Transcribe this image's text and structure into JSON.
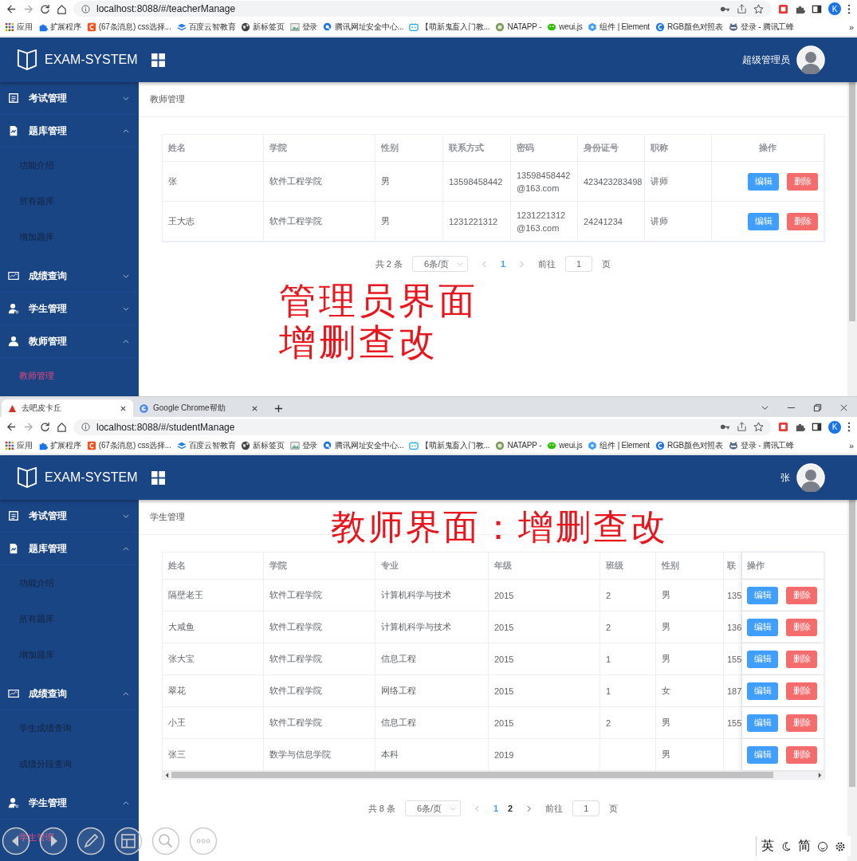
{
  "windows": [
    {
      "address": "localhost:8088/#/teacherManage",
      "profile": "K",
      "bookmarks": [
        "应用",
        "扩展程序",
        "(67条消息) css选择...",
        "百度云智教育",
        "新标签页",
        "登录",
        "腾讯网址安全中心...",
        "【萌新鬼畜入门教...",
        "NATAPP -",
        "weui.js",
        "组件 | Element",
        "RGB颜色对照表",
        "登录 - 腾讯工蜂"
      ],
      "bookmarks_more": "»",
      "app": {
        "logo": "EXAM-SYSTEM",
        "user": "超级管理员",
        "sidebar": [
          {
            "label": "考试管理",
            "expanded": false
          },
          {
            "label": "题库管理",
            "expanded": true,
            "children": [
              {
                "label": "功能介绍",
                "selected": false
              },
              {
                "label": "所有题库",
                "selected": false
              },
              {
                "label": "增加题库",
                "selected": false
              }
            ]
          },
          {
            "label": "成绩查询",
            "expanded": false
          },
          {
            "label": "学生管理",
            "expanded": false
          },
          {
            "label": "教师管理",
            "expanded": true,
            "children": [
              {
                "label": "教师管理",
                "selected": true
              }
            ]
          }
        ],
        "breadcrumb": "教师管理",
        "table": {
          "columns": [
            "姓名",
            "学院",
            "性别",
            "联系方式",
            "密码",
            "身份证号",
            "职称",
            "操作"
          ],
          "rows": [
            {
              "cells": [
                "张",
                "软件工程学院",
                "男",
                "13598458442",
                "13598458442@163.com",
                "423423283498",
                "讲师"
              ],
              "actions": [
                {
                  "kind": "edit",
                  "label": "编辑"
                },
                {
                  "kind": "delete",
                  "label": "删除"
                }
              ]
            },
            {
              "cells": [
                "王大志",
                "软件工程学院",
                "男",
                "1231221312",
                "1231221312@163.com",
                "24241234",
                "讲师"
              ],
              "actions": [
                {
                  "kind": "edit",
                  "label": "编辑"
                },
                {
                  "kind": "delete",
                  "label": "删除"
                }
              ]
            }
          ]
        },
        "pagination": {
          "total": "共 2 条",
          "page_size": "6条/页",
          "pages": [
            {
              "label": "1",
              "selected": true
            }
          ],
          "goto": "前往",
          "goto_value": "1",
          "unit": "页"
        },
        "annotation": [
          "管理员界面",
          "增删查改"
        ]
      }
    },
    {
      "tabs": [
        {
          "title": "去吧皮卡丘",
          "selected": true
        },
        {
          "title": "Google Chrome帮助",
          "selected": false
        }
      ],
      "address": "localhost:8088/#/studentManage",
      "profile": "K",
      "bookmarks": [
        "应用",
        "扩展程序",
        "(67条消息) css选择...",
        "百度云智教育",
        "新标签页",
        "登录",
        "腾讯网址安全中心...",
        "【萌新鬼畜入门教...",
        "NATAPP -",
        "weui.js",
        "组件 | Element",
        "RGB颜色对照表",
        "登录 - 腾讯工蜂"
      ],
      "bookmarks_more": "»",
      "app": {
        "logo": "EXAM-SYSTEM",
        "user": "张",
        "sidebar": [
          {
            "label": "考试管理",
            "expanded": false
          },
          {
            "label": "题库管理",
            "expanded": true,
            "children": [
              {
                "label": "功能介绍",
                "selected": false
              },
              {
                "label": "所有题库",
                "selected": false
              },
              {
                "label": "增加题库",
                "selected": false
              }
            ]
          },
          {
            "label": "成绩查询",
            "expanded": true,
            "children": [
              {
                "label": "学生成绩查询",
                "selected": false
              },
              {
                "label": "成绩分段查询",
                "selected": false
              }
            ]
          },
          {
            "label": "学生管理",
            "expanded": true,
            "children": [
              {
                "label": "学生管理",
                "selected": true
              }
            ]
          }
        ],
        "breadcrumb": "学生管理",
        "table": {
          "columns": [
            "姓名",
            "学院",
            "专业",
            "年级",
            "班级",
            "性别",
            "联",
            "操作"
          ],
          "rows": [
            {
              "cells": [
                "隔壁老王",
                "软件工程学院",
                "计算机科学与技术",
                "2015",
                "2",
                "男",
                "135"
              ],
              "actions": [
                {
                  "kind": "edit",
                  "label": "编辑"
                },
                {
                  "kind": "delete",
                  "label": "删除"
                }
              ]
            },
            {
              "cells": [
                "大咸鱼",
                "软件工程学院",
                "计算机科学与技术",
                "2015",
                "2",
                "男",
                "136"
              ],
              "actions": [
                {
                  "kind": "edit",
                  "label": "编辑"
                },
                {
                  "kind": "delete",
                  "label": "删除"
                }
              ]
            },
            {
              "cells": [
                "张大宝",
                "软件工程学院",
                "信息工程",
                "2015",
                "1",
                "男",
                "155"
              ],
              "actions": [
                {
                  "kind": "edit",
                  "label": "编辑"
                },
                {
                  "kind": "delete",
                  "label": "删除"
                }
              ]
            },
            {
              "cells": [
                "翠花",
                "软件工程学院",
                "网络工程",
                "2015",
                "1",
                "女",
                "187"
              ],
              "actions": [
                {
                  "kind": "edit",
                  "label": "编辑"
                },
                {
                  "kind": "delete",
                  "label": "删除"
                }
              ]
            },
            {
              "cells": [
                "小王",
                "软件工程学院",
                "信息工程",
                "2015",
                "2",
                "男",
                "155"
              ],
              "actions": [
                {
                  "kind": "edit",
                  "label": "编辑"
                },
                {
                  "kind": "delete",
                  "label": "删除"
                }
              ]
            },
            {
              "cells": [
                "张三",
                "数学与信息学院",
                "本科",
                "2019",
                "",
                "男",
                ""
              ],
              "actions": [
                {
                  "kind": "edit",
                  "label": "编辑"
                },
                {
                  "kind": "delete",
                  "label": "删除"
                }
              ]
            }
          ]
        },
        "pagination": {
          "total": "共 8 条",
          "page_size": "6条/页",
          "pages": [
            {
              "label": "1",
              "selected": true
            },
            {
              "label": "2",
              "selected": false
            }
          ],
          "goto": "前往",
          "goto_value": "1",
          "unit": "页"
        },
        "annotation": [
          "教师界面：增删查改"
        ]
      }
    }
  ],
  "ime": {
    "lang": "英",
    "script": "简"
  }
}
